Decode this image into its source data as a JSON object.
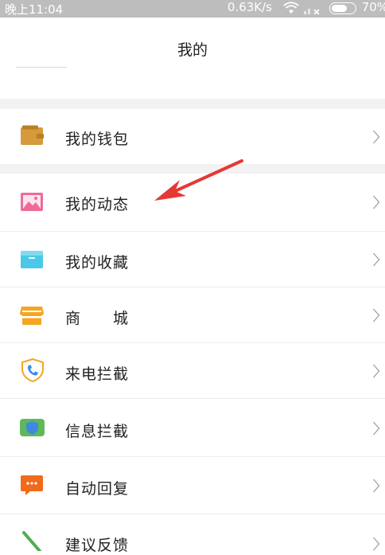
{
  "status_bar": {
    "time": "晚上11:04",
    "net_speed": "0.63K/s",
    "battery_level": 70,
    "battery": "70%"
  },
  "header": {
    "title": "我的"
  },
  "colors": {
    "wallet": "#d49a3c",
    "moments": "#ec6b9a",
    "favorites": "#49c8e8",
    "mall": "#f5a623",
    "call_block": "#3f8ae0",
    "msg_block": "#5fb85a",
    "auto_reply": "#f06a1c",
    "feedback": "#4caf50",
    "annotation_arrow": "#e53935"
  },
  "menu": {
    "wallet": {
      "label": "我的钱包",
      "icon": "wallet-icon"
    },
    "moments": {
      "label": "我的动态",
      "icon": "picture-icon"
    },
    "favorites": {
      "label": "我的收藏",
      "icon": "folder-icon"
    },
    "mall": {
      "label": "商　　城",
      "icon": "store-icon"
    },
    "call_block": {
      "label": "来电拦截",
      "icon": "shield-phone-icon"
    },
    "msg_block": {
      "label": "信息拦截",
      "icon": "shield-message-icon"
    },
    "auto_reply": {
      "label": "自动回复",
      "icon": "chat-bubble-icon"
    },
    "feedback": {
      "label": "建议反馈",
      "icon": "pencil-icon"
    }
  }
}
